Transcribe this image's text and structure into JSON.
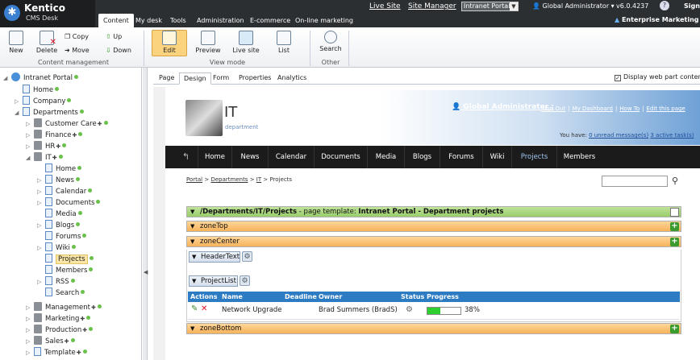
{
  "app": {
    "logo_title": "Kentico",
    "logo_subtitle": "CMS Desk"
  },
  "main_tabs": [
    {
      "label": "Content",
      "active": true
    },
    {
      "label": "My desk"
    },
    {
      "label": "Tools"
    },
    {
      "label": "Administration"
    },
    {
      "label": "E-commerce"
    },
    {
      "label": "On-line marketing"
    }
  ],
  "topbar": {
    "live_site": "Live Site",
    "site_manager": "Site Manager",
    "site_select": "Intranet Portal",
    "user": "Global Administrator",
    "version": "v6.0.4237",
    "sign": "Sign",
    "ems": "Enterprise Marketing So"
  },
  "ribbon": {
    "new": "New",
    "delete": "Delete",
    "copy": "Copy",
    "move": "Move",
    "up": "Up",
    "down": "Down",
    "group_content": "Content management",
    "edit": "Edit",
    "preview": "Preview",
    "live_site": "Live site",
    "list": "List",
    "group_view": "View mode",
    "search": "Search",
    "group_other": "Other"
  },
  "tree": {
    "root": "Intranet Portal",
    "items": [
      "Home",
      "Company",
      "Departments",
      "Customer Care",
      "Finance",
      "HR",
      "IT",
      "Home",
      "News",
      "Calendar",
      "Documents",
      "Media",
      "Blogs",
      "Forums",
      "Wiki",
      "Projects",
      "Members",
      "RSS",
      "Search",
      "Management",
      "Marketing",
      "Production",
      "Sales",
      "Template"
    ]
  },
  "content_tabs": [
    {
      "label": "Page"
    },
    {
      "label": "Design",
      "active": true
    },
    {
      "label": "Form"
    },
    {
      "label": "Properties"
    },
    {
      "label": "Analytics"
    }
  ],
  "display_web_part": "Display web part content",
  "site": {
    "title": "IT",
    "subtitle": "department",
    "user": "Global Administrator",
    "user_sep": ":",
    "links": [
      "Sign Out",
      "My Dashboard",
      "How To",
      "Edit this page"
    ],
    "you_have_prefix": "You have:",
    "unread": "0 unread message(s)",
    "active_tasks": "3 active task(s)",
    "nav": [
      "Home",
      "News",
      "Calendar",
      "Documents",
      "Media",
      "Blogs",
      "Forums",
      "Wiki",
      "Projects",
      "Members"
    ],
    "nav_active": "Projects",
    "breadcrumb": [
      "Portal",
      "Departments",
      "IT",
      "Projects"
    ]
  },
  "zones": {
    "template_bar_path": "/Departments/IT/Projects",
    "template_bar_mid": " - page template: ",
    "template_bar_name": "Intranet Portal - Department projects",
    "zone_top": "zoneTop",
    "zone_center": "zoneCenter",
    "wp_header": "HeaderText",
    "wp_projects": "ProjectList",
    "zone_bottom": "zoneBottom"
  },
  "grid": {
    "headers": [
      "Actions",
      "Name",
      "Deadline",
      "Owner",
      "Status",
      "Progress"
    ],
    "rows": [
      {
        "name": "Network Upgrade",
        "deadline": "",
        "owner": "Brad Summers (BradS)",
        "progress": 0.38,
        "progress_label": "38%"
      }
    ]
  },
  "colors": {
    "header": "#2c2f32",
    "accent": "#2d7cc3",
    "zone_green": "#98cc6a",
    "zone_orange": "#f6b35a",
    "selected": "#fbe6a6",
    "progress": "#2fcf2f"
  }
}
